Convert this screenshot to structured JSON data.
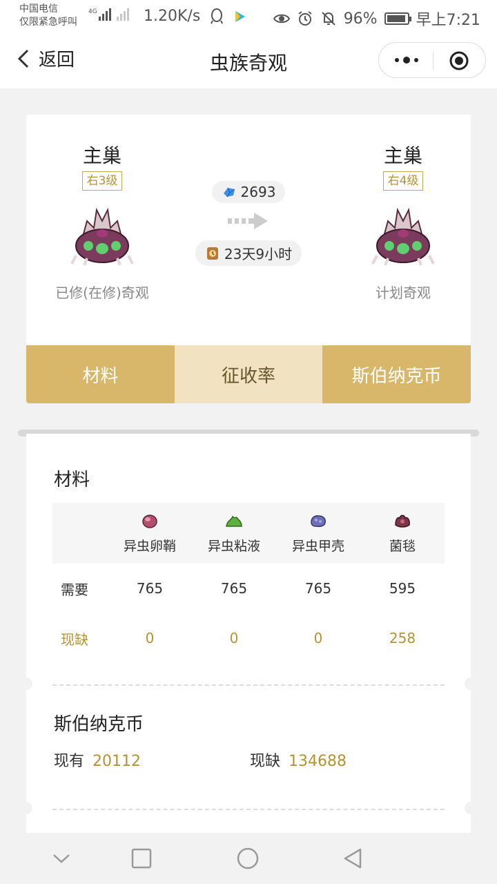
{
  "status_bar": {
    "carrier_line1": "中国电信",
    "carrier_line2": "仅限紧急呼叫",
    "network_badge": "4G",
    "speed": "1.20K/s",
    "battery": "96%",
    "time": "早上7:21",
    "icons": [
      "signal-icon",
      "qq-icon",
      "video-play-icon",
      "eye-icon",
      "alarm-icon",
      "mute-icon",
      "battery-icon"
    ]
  },
  "nav": {
    "back_label": "返回",
    "title": "虫族奇观",
    "capsule_icons": [
      "more-dots-icon",
      "close-target-icon"
    ]
  },
  "upgrade": {
    "current": {
      "name": "主巢",
      "level": "右3级",
      "caption": "已修(在修)奇观"
    },
    "target": {
      "name": "主巢",
      "level": "右4级",
      "caption": "计划奇观"
    },
    "cost_crystal": "2693",
    "duration": "23天9小时"
  },
  "tabs": [
    {
      "label": "材料",
      "state": "gold"
    },
    {
      "label": "征收率",
      "state": "active"
    },
    {
      "label": "斯伯纳克币",
      "state": "gold"
    }
  ],
  "materials": {
    "title": "材料",
    "items": [
      {
        "name": "异虫卵鞘",
        "icon": "egg-sac-icon",
        "color": "#b2506c"
      },
      {
        "name": "异虫粘液",
        "icon": "slime-icon",
        "color": "#5fae3e"
      },
      {
        "name": "异虫甲壳",
        "icon": "carapace-icon",
        "color": "#6f6fb8"
      },
      {
        "name": "菌毯",
        "icon": "creep-icon",
        "color": "#7a3848"
      }
    ],
    "rows": [
      {
        "label": "需要",
        "values": [
          "765",
          "765",
          "765",
          "595"
        ],
        "style": "normal"
      },
      {
        "label": "现缺",
        "values": [
          "0",
          "0",
          "0",
          "258"
        ],
        "style": "gold"
      }
    ]
  },
  "coins": {
    "title": "斯伯纳克币",
    "have_label": "现有",
    "have_value": "20112",
    "lack_label": "现缺",
    "lack_value": "134688"
  },
  "colors": {
    "gold": "#d9b76a",
    "gold_light": "#f1e2c2",
    "gold_text": "#b89233"
  }
}
